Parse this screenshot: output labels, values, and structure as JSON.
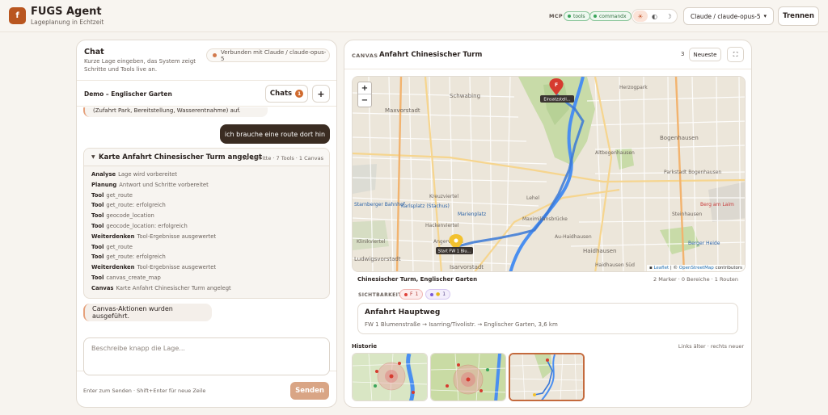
{
  "header": {
    "logo_letter": "f",
    "app_title": "FUGS Agent",
    "app_subtitle": "Lageplanung in Echtzeit",
    "mcp_label": "MCP",
    "mcp_chips": [
      "tools",
      "commandx"
    ],
    "theme_icons": [
      "sun-icon",
      "contrast-icon",
      "moon-icon"
    ],
    "theme_active": "light",
    "model_select_value": "Claude / claude-opus-5",
    "disconnect_label": "Trennen"
  },
  "chat": {
    "title": "Chat",
    "description": "Kurze Lage eingeben, das System zeigt Schritte und Tools live an.",
    "connection_status": "Verbunden mit Claude / claude-opus-5",
    "demo_title": "Demo – Englischer Garten",
    "chats_button": "Chats",
    "chats_count": "1",
    "new_button": "+",
    "previous_message": "(Zufahrt Park, Bereitstellung, Wasserentnahme) auf.",
    "user_message": "ich brauche eine route dort hin",
    "activity": {
      "title": "Karte Anfahrt Chinesischer Turm angelegt",
      "meta": "12 Schritte · 7 Tools · 1 Canvas",
      "steps": [
        {
          "kind": "Analyse",
          "text": "Lage wird vorbereitet"
        },
        {
          "kind": "Planung",
          "text": "Antwort und Schritte vorbereitet"
        },
        {
          "kind": "Tool",
          "text": "get_route"
        },
        {
          "kind": "Tool",
          "text": "get_route: erfolgreich"
        },
        {
          "kind": "Tool",
          "text": "geocode_location"
        },
        {
          "kind": "Tool",
          "text": "geocode_location: erfolgreich"
        },
        {
          "kind": "Weiterdenken",
          "text": "Tool-Ergebnisse ausgewertet"
        },
        {
          "kind": "Tool",
          "text": "get_route"
        },
        {
          "kind": "Tool",
          "text": "get_route: erfolgreich"
        },
        {
          "kind": "Weiterdenken",
          "text": "Tool-Ergebnisse ausgewertet"
        },
        {
          "kind": "Tool",
          "text": "canvas_create_map"
        },
        {
          "kind": "Canvas",
          "text": "Karte Anfahrt Chinesischer Turm angelegt"
        }
      ]
    },
    "system_message": "Canvas-Aktionen wurden ausgeführt.",
    "composer_placeholder": "Beschreibe knapp die Lage...",
    "hint": "Enter zum Senden · Shift+Enter für neue Zeile",
    "send_label": "Senden"
  },
  "canvas": {
    "label": "CANVAS",
    "title": "Anfahrt Chinesischer Turm",
    "count": "3",
    "newest_button": "Neueste",
    "map": {
      "zoom_in": "+",
      "zoom_out": "−",
      "marker_f_letter": "F",
      "marker_f_label": "Einsatzstell...",
      "marker_start_label": "Start FW 1 Blu...",
      "attribution_leaflet": "Leaflet",
      "attribution_osm": "OpenStreetMap",
      "attribution_suffix": "contributors",
      "place_labels": [
        "Maxvorstadt",
        "Schwabing",
        "Bogenhausen",
        "Altbogenhausen",
        "Parkstadt Bogenhausen",
        "Steinhausen",
        "Haidhausen",
        "Au-Haidhausen",
        "Isarvorstadt",
        "Ludwigsvorstadt",
        "Hackenviertel",
        "Kreuzviertel",
        "Marienplatz",
        "Karlsplatz (Stachus)",
        "Lehel",
        "Maximiliansbrücke",
        "Haidhausen Süd",
        "Berg am Laim",
        "Starnberger Bahnhof",
        "Angerviertel",
        "Klinikviertel",
        "Herzogpark",
        "Berger Heide"
      ]
    },
    "map_title": "Chinesischer Turm, Englischer Garten",
    "map_meta": "2 Marker · 0 Bereiche · 1 Routen",
    "visibility_label": "SICHTBARKEIT",
    "visibility_chips": [
      {
        "label": "F",
        "count": "1",
        "color": "#e0413a"
      },
      {
        "label": "●",
        "count": "1",
        "color": "#e6b81a"
      }
    ],
    "route": {
      "title": "Anfahrt Hauptweg",
      "description": "FW 1 Blumenstraße → Isarring/Tivolistr. → Englischer Garten, 3,6 km"
    },
    "history_label": "Historie",
    "history_hint": "Links älter · rechts neuer"
  },
  "colors": {
    "accent": "#b9561f",
    "route": "#3a78d6",
    "river": "#4a8ff0",
    "park": "#c8dba8",
    "marker_red": "#d63b2f",
    "marker_yellow": "#f2c12e"
  }
}
